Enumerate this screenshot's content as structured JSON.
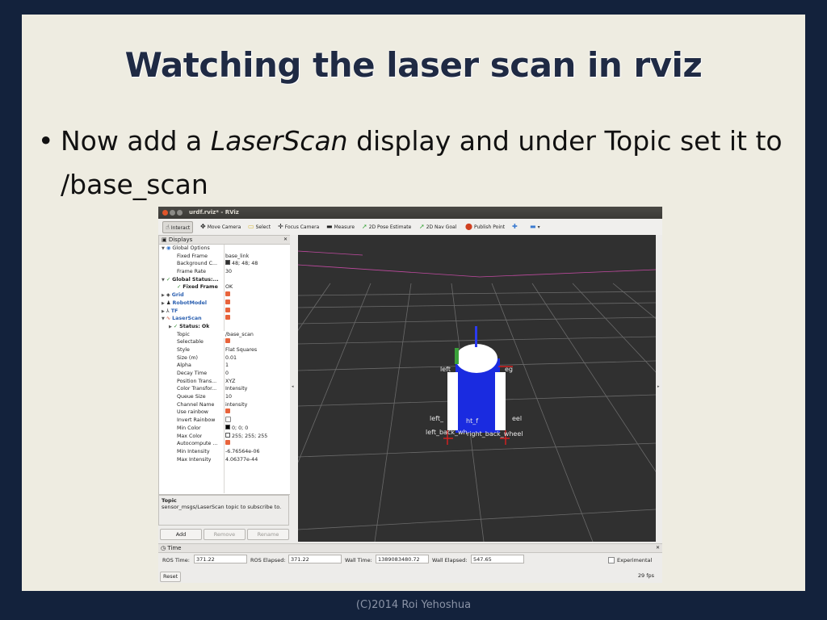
{
  "slide": {
    "title": "Watching the laser scan in rviz",
    "bullet_pre": "Now add a ",
    "bullet_em": "LaserScan",
    "bullet_post": " display and under Topic set it to /base_scan",
    "footer": "(C)2014 Roi Yehoshua"
  },
  "window": {
    "title": "urdf.rviz* - RViz"
  },
  "toolbar": {
    "interact": "Interact",
    "move_camera": "Move Camera",
    "select": "Select",
    "focus_camera": "Focus Camera",
    "measure": "Measure",
    "pose_estimate": "2D Pose Estimate",
    "nav_goal": "2D Nav Goal",
    "publish_point": "Publish Point"
  },
  "displays": {
    "header": "Displays",
    "rows": [
      {
        "key": "Global Options",
        "value": ""
      },
      {
        "key": "Fixed Frame",
        "value": "base_link"
      },
      {
        "key": "Background C...",
        "value": "48; 48; 48"
      },
      {
        "key": "Frame Rate",
        "value": "30"
      },
      {
        "key": "Global Status:...",
        "value": ""
      },
      {
        "key": "Fixed Frame",
        "value": "OK"
      },
      {
        "key": "Grid",
        "value": ""
      },
      {
        "key": "RobotModel",
        "value": ""
      },
      {
        "key": "TF",
        "value": ""
      },
      {
        "key": "LaserScan",
        "value": ""
      },
      {
        "key": "Status: Ok",
        "value": ""
      },
      {
        "key": "Topic",
        "value": "/base_scan"
      },
      {
        "key": "Selectable",
        "value": ""
      },
      {
        "key": "Style",
        "value": "Flat Squares"
      },
      {
        "key": "Size (m)",
        "value": "0.01"
      },
      {
        "key": "Alpha",
        "value": "1"
      },
      {
        "key": "Decay Time",
        "value": "0"
      },
      {
        "key": "Position Trans...",
        "value": "XYZ"
      },
      {
        "key": "Color Transfor...",
        "value": "Intensity"
      },
      {
        "key": "Queue Size",
        "value": "10"
      },
      {
        "key": "Channel Name",
        "value": "intensity"
      },
      {
        "key": "Use rainbow",
        "value": ""
      },
      {
        "key": "Invert Rainbow",
        "value": ""
      },
      {
        "key": "Min Color",
        "value": "0; 0; 0"
      },
      {
        "key": "Max Color",
        "value": "255; 255; 255"
      },
      {
        "key": "Autocompute ...",
        "value": ""
      },
      {
        "key": "Min Intensity",
        "value": "-6.76564e-06"
      },
      {
        "key": "Max Intensity",
        "value": "4.06377e-44"
      }
    ],
    "help_title": "Topic",
    "help_text": "sensor_msgs/LaserScan topic to subscribe to.",
    "add": "Add",
    "remove": "Remove",
    "rename": "Rename"
  },
  "view3d": {
    "labels": {
      "left_leg": "left_",
      "right_leg": "eg",
      "left_front_wheel": "left_",
      "right_front_wheel": "eel",
      "overlap1": "ht_f",
      "left_back_wheel": "left_back_wh",
      "overlap2": "right_back_wheel"
    }
  },
  "time": {
    "header": "Time",
    "ros_time_label": "ROS Time:",
    "ros_time": "371.22",
    "ros_elapsed_label": "ROS Elapsed:",
    "ros_elapsed": "371.22",
    "wall_time_label": "Wall Time:",
    "wall_time": "1389083480.72",
    "wall_elapsed_label": "Wall Elapsed:",
    "wall_elapsed": "547.65",
    "experimental": "Experimental",
    "reset": "Reset",
    "fps": "29 fps"
  }
}
